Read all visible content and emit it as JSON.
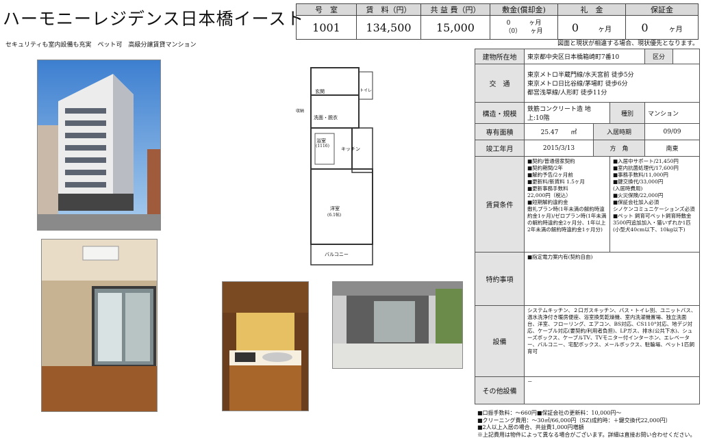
{
  "title": "ハーモニーレジデンス日本橋イースト",
  "header": {
    "cols": [
      "号　室",
      "賃　料（円）",
      "共 益 費（円）",
      "敷金(償却金)",
      "礼　金",
      "保証金"
    ],
    "room": "1001",
    "rent": "134,500",
    "fee": "15,000",
    "deposit_line1": "0　　　ヶ月",
    "deposit_line2": "（0）　　ヶ月",
    "key_money": "0",
    "key_unit": "ヶ月",
    "guarantee": "0",
    "guarantee_unit": "ヶ月"
  },
  "lead": "セキュリティも室内設備も充実　ペット可　高級分譲賃貸マンション",
  "note": "図面と現状が相違する場合、現状優先となります。",
  "floorplan": {
    "labels": [
      "玄関",
      "洗面・脱衣",
      "浴室",
      "(1116)",
      "キッチン",
      "洋室",
      "(6.1帖)",
      "バルコニー",
      "トイレ",
      "収納"
    ]
  },
  "info": {
    "address_label": "建物所在地",
    "address": "東京都中央区日本橋箱崎町7番10",
    "ward_label": "区分",
    "access_label": "交　通",
    "access": [
      "東京メトロ半蔵門線/水天宮前 徒歩5分",
      "東京メトロ日比谷線/茅場町 徒歩6分",
      "都営浅草線/人形町 徒歩11分"
    ],
    "structure_label": "構造・規模",
    "structure": "鉄筋コンクリート造 地上:10階",
    "type_label": "種別",
    "type": "マンション",
    "area_label": "専有面積",
    "area": "25.47　　㎡",
    "move_label": "入居時期",
    "move": "09/09",
    "built_label": "竣工年月",
    "built": "2015/3/13",
    "direction_label": "方　角",
    "direction": "南東",
    "terms_label": "賃貸条件",
    "terms_left": [
      "■契約/普通借家契約",
      "■契約期間/2年",
      "■解約予告/2ヶ月前",
      "■更新料/新賃料 1.5ヶ月",
      "■更新事務手数料",
      "22,000円（税込）",
      "■短期解約違約金",
      "敷礼プラン時(1年未満の解約時違約金1ヶ月)/ゼロプラン時(1年未満の解約時違約金2ヶ月分、1年以上2年未満の解約時違約金1ヶ月分)"
    ],
    "terms_right": [
      "■入居中サポート/21,450円",
      "■室内抗菌処理代/17,600円",
      "■事務手数料/11,000円",
      "■鍵交換代/33,000円",
      "(入居時費用)",
      "■火災保険/22,000円",
      "■保証会社加入必須",
      "シノケンコミュニケーションズ必須",
      "■ペット 飼育可ペット飼育時敷金 3500円追加加入・猫いずれか1匹(小型犬40cm以下、10kg以下)"
    ],
    "special_label": "特約事項",
    "special": "■指定電力案内有(契約自由)",
    "equip_label": "設備",
    "equip": "システムキッチン、２口ガスキッチン、バス・トイレ別、ユニットバス、温水洗浄付き暖房便座、浴室換気乾燥機、室内洗濯機置場、独立洗面台、洋室、フローリング、エアコン、BS対応、CS110°対応、地デジ対応、ケーブル対応(要契約/利用者負担)、LPガス、排水(公共下水)、シューズボックス、ケーブルTV、TVモニター付インターホン、エレベーター、バルコニー、宅配ボックス、メールボックス、駐輪場、ペット1匹飼育可",
    "other_label": "その他設備",
    "other": "－"
  },
  "footer": [
    "■口振手数料：～660円■保証会社の更新料：10,000円～",
    "■クリーニング費用：～30㎡/66,000円（SZ)成約時：＋鍵交換代22,000円）",
    "■2人以上入居の場合、共益費1,000円増額",
    "※上記費用は物件によって異なる場合がございます。詳細は直接お問い合わせください。"
  ]
}
